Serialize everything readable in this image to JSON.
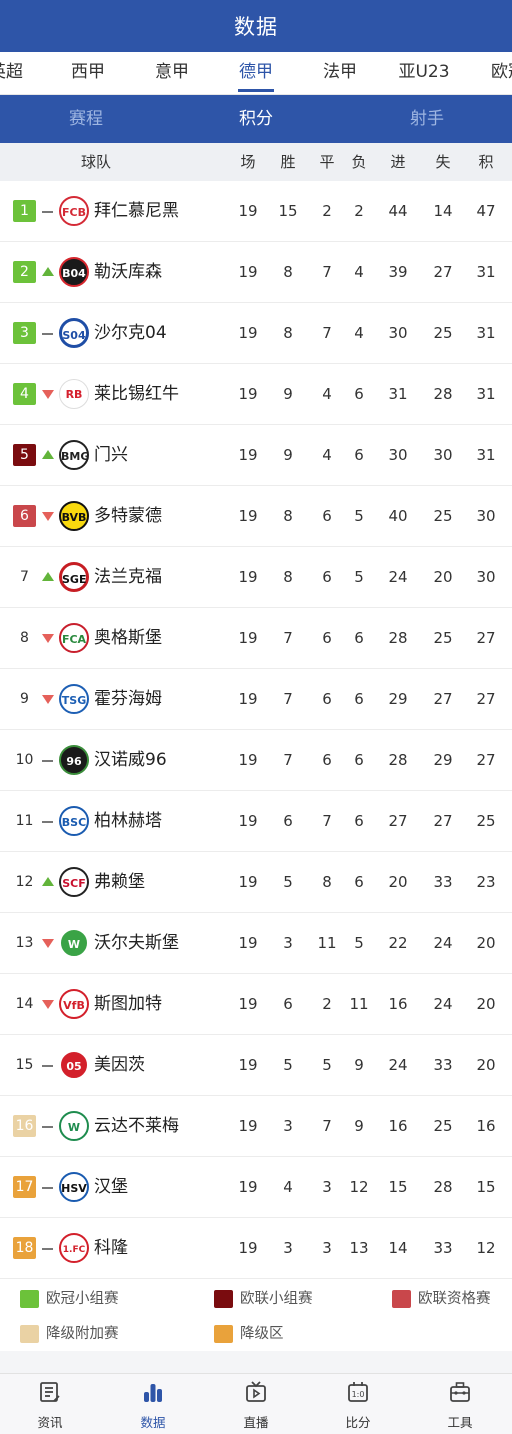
{
  "header": {
    "title": "数据"
  },
  "league_tabs": [
    {
      "label": "英超",
      "visible_text": "英超"
    },
    {
      "label": "西甲"
    },
    {
      "label": "意甲"
    },
    {
      "label": "德甲"
    },
    {
      "label": "法甲"
    },
    {
      "label": "亚U23"
    },
    {
      "label": "欧冠"
    }
  ],
  "sub_tabs": [
    {
      "label": "赛程"
    },
    {
      "label": "积分"
    },
    {
      "label": "射手"
    }
  ],
  "table_header": {
    "team": "球队",
    "played": "场",
    "won": "胜",
    "drawn": "平",
    "lost": "负",
    "goals_for": "进",
    "goals_against": "失",
    "points": "积"
  },
  "colors": {
    "accent": "#2e55a8",
    "ucl_group": "#6cc23a",
    "uel_group": "#7a0c0f",
    "uel_qualifying": "#c9474b",
    "relegation_playoff": "#ead2a4",
    "relegation_zone": "#e9a23b"
  },
  "standings": [
    {
      "rank": "1",
      "trend": "same",
      "logo": "bayern-logo",
      "team": "拜仁慕尼黑",
      "played": "19",
      "won": "15",
      "drawn": "2",
      "lost": "2",
      "gf": "44",
      "ga": "14",
      "pts": "47",
      "zone": "ucl_group"
    },
    {
      "rank": "2",
      "trend": "up",
      "logo": "leverkusen-logo",
      "team": "勒沃库森",
      "played": "19",
      "won": "8",
      "drawn": "7",
      "lost": "4",
      "gf": "39",
      "ga": "27",
      "pts": "31",
      "zone": "ucl_group"
    },
    {
      "rank": "3",
      "trend": "same",
      "logo": "schalke-logo",
      "team": "沙尔克04",
      "played": "19",
      "won": "8",
      "drawn": "7",
      "lost": "4",
      "gf": "30",
      "ga": "25",
      "pts": "31",
      "zone": "ucl_group"
    },
    {
      "rank": "4",
      "trend": "down",
      "logo": "leipzig-logo",
      "team": "莱比锡红牛",
      "played": "19",
      "won": "9",
      "drawn": "4",
      "lost": "6",
      "gf": "31",
      "ga": "28",
      "pts": "31",
      "zone": "ucl_group"
    },
    {
      "rank": "5",
      "trend": "up",
      "logo": "gladbach-logo",
      "team": "门兴",
      "played": "19",
      "won": "9",
      "drawn": "4",
      "lost": "6",
      "gf": "30",
      "ga": "30",
      "pts": "31",
      "zone": "uel_group"
    },
    {
      "rank": "6",
      "trend": "down",
      "logo": "dortmund-logo",
      "team": "多特蒙德",
      "played": "19",
      "won": "8",
      "drawn": "6",
      "lost": "5",
      "gf": "40",
      "ga": "25",
      "pts": "30",
      "zone": "uel_qualifying"
    },
    {
      "rank": "7",
      "trend": "up",
      "logo": "frankfurt-logo",
      "team": "法兰克福",
      "played": "19",
      "won": "8",
      "drawn": "6",
      "lost": "5",
      "gf": "24",
      "ga": "20",
      "pts": "30",
      "zone": ""
    },
    {
      "rank": "8",
      "trend": "down",
      "logo": "augsburg-logo",
      "team": "奥格斯堡",
      "played": "19",
      "won": "7",
      "drawn": "6",
      "lost": "6",
      "gf": "28",
      "ga": "25",
      "pts": "27",
      "zone": ""
    },
    {
      "rank": "9",
      "trend": "down",
      "logo": "hoffenheim-logo",
      "team": "霍芬海姆",
      "played": "19",
      "won": "7",
      "drawn": "6",
      "lost": "6",
      "gf": "29",
      "ga": "27",
      "pts": "27",
      "zone": ""
    },
    {
      "rank": "10",
      "trend": "same",
      "logo": "hannover-logo",
      "team": "汉诺威96",
      "played": "19",
      "won": "7",
      "drawn": "6",
      "lost": "6",
      "gf": "28",
      "ga": "29",
      "pts": "27",
      "zone": ""
    },
    {
      "rank": "11",
      "trend": "same",
      "logo": "hertha-logo",
      "team": "柏林赫塔",
      "played": "19",
      "won": "6",
      "drawn": "7",
      "lost": "6",
      "gf": "27",
      "ga": "27",
      "pts": "25",
      "zone": ""
    },
    {
      "rank": "12",
      "trend": "up",
      "logo": "freiburg-logo",
      "team": "弗赖堡",
      "played": "19",
      "won": "5",
      "drawn": "8",
      "lost": "6",
      "gf": "20",
      "ga": "33",
      "pts": "23",
      "zone": ""
    },
    {
      "rank": "13",
      "trend": "down",
      "logo": "wolfsburg-logo",
      "team": "沃尔夫斯堡",
      "played": "19",
      "won": "3",
      "drawn": "11",
      "lost": "5",
      "gf": "22",
      "ga": "24",
      "pts": "20",
      "zone": ""
    },
    {
      "rank": "14",
      "trend": "down",
      "logo": "stuttgart-logo",
      "team": "斯图加特",
      "played": "19",
      "won": "6",
      "drawn": "2",
      "lost": "11",
      "gf": "16",
      "ga": "24",
      "pts": "20",
      "zone": ""
    },
    {
      "rank": "15",
      "trend": "same",
      "logo": "mainz-logo",
      "team": "美因茨",
      "played": "19",
      "won": "5",
      "drawn": "5",
      "lost": "9",
      "gf": "24",
      "ga": "33",
      "pts": "20",
      "zone": ""
    },
    {
      "rank": "16",
      "trend": "same",
      "logo": "bremen-logo",
      "team": "云达不莱梅",
      "played": "19",
      "won": "3",
      "drawn": "7",
      "lost": "9",
      "gf": "16",
      "ga": "25",
      "pts": "16",
      "zone": "relegation_playoff"
    },
    {
      "rank": "17",
      "trend": "same",
      "logo": "hamburg-logo",
      "team": "汉堡",
      "played": "19",
      "won": "4",
      "drawn": "3",
      "lost": "12",
      "gf": "15",
      "ga": "28",
      "pts": "15",
      "zone": "relegation_zone"
    },
    {
      "rank": "18",
      "trend": "same",
      "logo": "koln-logo",
      "team": "科隆",
      "played": "19",
      "won": "3",
      "drawn": "3",
      "lost": "13",
      "gf": "14",
      "ga": "33",
      "pts": "12",
      "zone": "relegation_zone"
    }
  ],
  "legend": [
    {
      "label": "欧冠小组赛",
      "zone": "ucl_group"
    },
    {
      "label": "欧联小组赛",
      "zone": "uel_group"
    },
    {
      "label": "欧联资格赛",
      "zone": "uel_qualifying"
    },
    {
      "label": "降级附加赛",
      "zone": "relegation_playoff"
    },
    {
      "label": "降级区",
      "zone": "relegation_zone"
    }
  ],
  "bottom_nav": [
    {
      "label": "资讯",
      "icon": "news-icon"
    },
    {
      "label": "数据",
      "icon": "bar-chart-icon"
    },
    {
      "label": "直播",
      "icon": "tv-icon"
    },
    {
      "label": "比分",
      "icon": "scoreboard-icon"
    },
    {
      "label": "工具",
      "icon": "toolbox-icon"
    }
  ]
}
